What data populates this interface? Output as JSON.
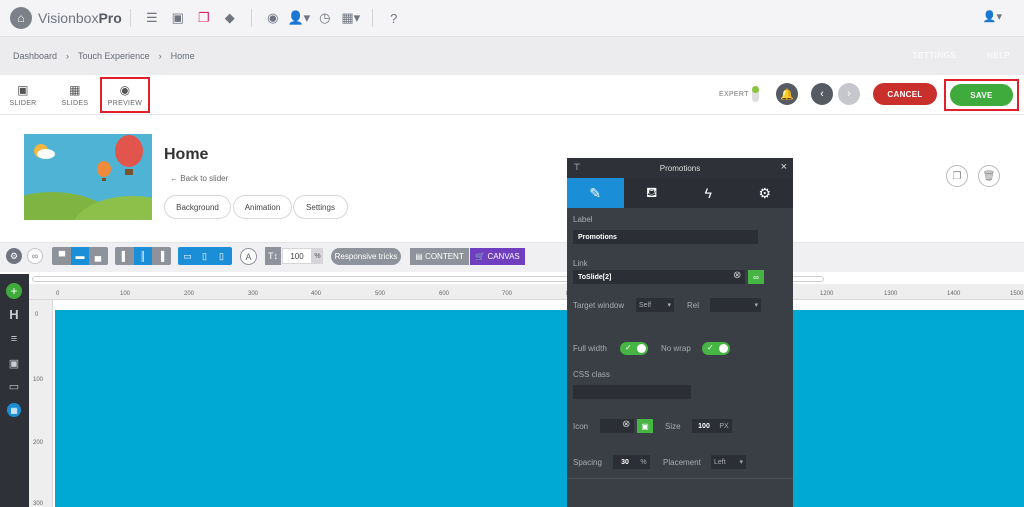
{
  "app": {
    "logo_regular": "Visionbox",
    "logo_bold": "Pro"
  },
  "breadcrumb": {
    "items": [
      "Dashboard",
      "Touch Experience",
      "Home"
    ],
    "right": [
      "SETTINGS",
      "HELP"
    ]
  },
  "toolbar": {
    "slider": "SLIDER",
    "slides": "SLIDES",
    "preview": "PREVIEW",
    "expert": "EXPERT",
    "cancel": "CANCEL",
    "save": "SAVE"
  },
  "slide": {
    "title": "Home",
    "back": "Back to slider",
    "tabs": [
      "Background",
      "Animation",
      "Settings"
    ]
  },
  "editor": {
    "zoom": "100",
    "zoom_unit": "%",
    "responsive": "Responsive tricks",
    "content": "CONTENT",
    "canvas": "CANVAS"
  },
  "ruler": {
    "h": [
      "0",
      "100",
      "200",
      "300",
      "400",
      "500",
      "600",
      "700",
      "800",
      "900",
      "1000",
      "1100",
      "1200",
      "1300",
      "1400",
      "1500"
    ],
    "v": [
      "0",
      "100",
      "200",
      "300"
    ]
  },
  "panel": {
    "title": "Promotions",
    "label_label": "Label",
    "label_value": "Promotions",
    "link_label": "Link",
    "link_value": "ToSlide[2]",
    "target_label": "Target window",
    "target_value": "Self",
    "rel_label": "Rel",
    "rel_value": "",
    "fullwidth_label": "Full width",
    "nowrap_label": "No wrap",
    "css_label": "CSS class",
    "css_value": "",
    "icon_label": "Icon",
    "size_label": "Size",
    "size_value": "100",
    "size_unit": "PX",
    "spacing_label": "Spacing",
    "spacing_value": "30",
    "spacing_unit": "%",
    "placement_label": "Placement",
    "placement_value": "Left"
  }
}
